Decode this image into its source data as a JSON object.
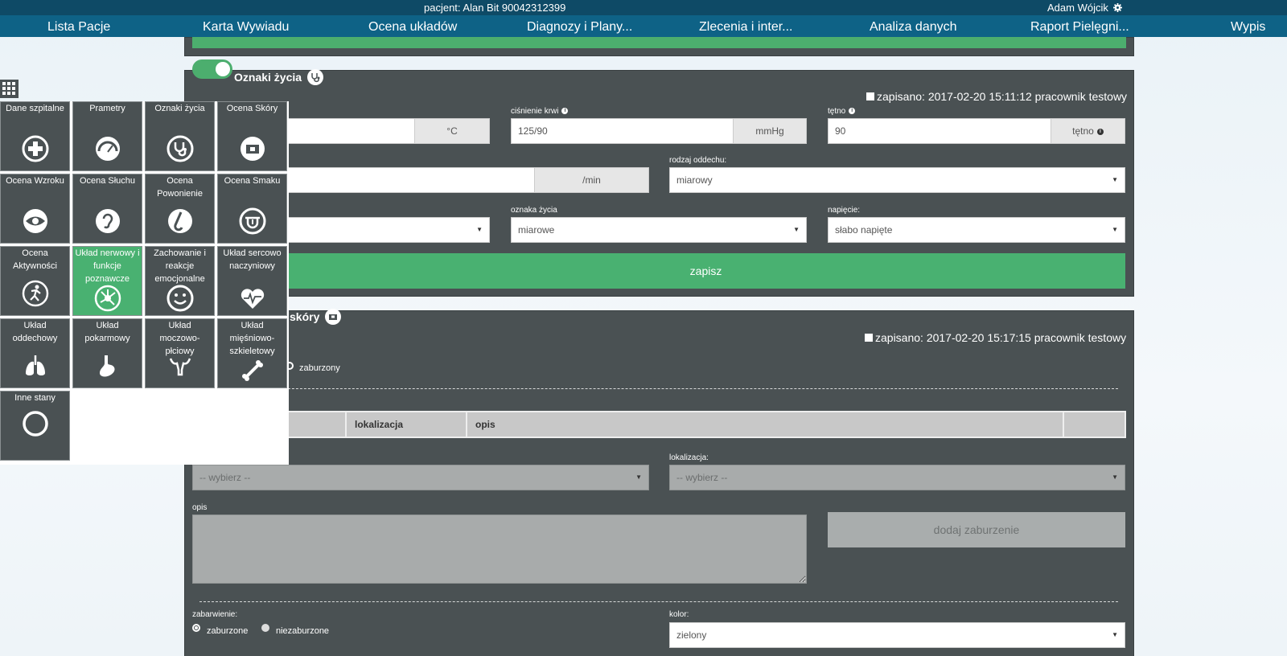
{
  "topbar": {
    "patient": "pacjent: Alan Bit 90042312399",
    "user": "Adam Wójcik",
    "user_icon": "gear-icon"
  },
  "nav": [
    {
      "label": "Lista Pacje"
    },
    {
      "label": "Karta Wywiadu"
    },
    {
      "label": "Ocena układów"
    },
    {
      "label": "Diagnozy i Plany..."
    },
    {
      "label": "Zlecenia i inter..."
    },
    {
      "label": "Analiza danych"
    },
    {
      "label": "Raport Pielęgni..."
    },
    {
      "label": "Wypis"
    }
  ],
  "vitals": {
    "title": "Oznaki życia",
    "enabled": true,
    "saved": "zapisano: 2017-02-20 15:11:12 pracownik testowy",
    "temp_unit": "°C",
    "bp_label": "ciśnienie krwi",
    "bp_value": "125/90",
    "bp_unit": "mmHg",
    "pulse_label": "tętno",
    "pulse_value": "90",
    "pulse_unit": "tętno",
    "resp_unit": "/min",
    "breath_type_label": "rodzaj oddechu:",
    "breath_type_value": "miarowy",
    "sign_label": "oznaka życia",
    "sign_value": "miarowe",
    "tension_label": "napięcie:",
    "tension_value": "słabo napięte",
    "save_button": "zapisz"
  },
  "skin": {
    "title": "skóry",
    "saved": "zapisano: 2017-02-20 15:17:15 pracownik testowy",
    "radio_zaburzony": "zaburzony",
    "table_headers": [
      "lokalizacja",
      "opis"
    ],
    "select1_placeholder": "-- wybierz --",
    "location_label": "lokalizacja:",
    "select2_placeholder": "-- wybierz --",
    "opis_label": "opis",
    "add_button": "dodaj zaburzenie",
    "color_section_label": "zabarwienie:",
    "radio_disturbed": "zaburzone",
    "radio_undisturbed": "niezaburzone",
    "color_label": "kolor:",
    "color_value": "zielony"
  },
  "tiles": [
    {
      "label": "Dane szpitalne",
      "icon": "medical-cross-icon"
    },
    {
      "label": "Prametry",
      "icon": "gauge-icon"
    },
    {
      "label": "Oznaki życia",
      "icon": "stethoscope-icon"
    },
    {
      "label": "Ocena Skóry",
      "icon": "skin-icon"
    },
    {
      "label": "Ocena Wzroku",
      "icon": "eye-icon"
    },
    {
      "label": "Ocena Słuchu",
      "icon": "ear-icon"
    },
    {
      "label": "Ocena Powonienie",
      "icon": "nose-icon"
    },
    {
      "label": "Ocena Smaku",
      "icon": "tongue-icon"
    },
    {
      "label": "Ocena Aktywności",
      "icon": "activity-icon"
    },
    {
      "label": "Układ nerwowy i funkcje poznawcze",
      "icon": "neuron-icon",
      "active": true
    },
    {
      "label": "Zachowanie i reakcje emocjonalne",
      "icon": "smiley-icon"
    },
    {
      "label": "Układ sercowo naczyniowy",
      "icon": "heart-icon"
    },
    {
      "label": "Układ oddechowy",
      "icon": "lungs-icon"
    },
    {
      "label": "Układ pokarmowy",
      "icon": "stomach-icon"
    },
    {
      "label": "Układ moczowo-płciowy",
      "icon": "uterus-icon"
    },
    {
      "label": "Układ mięśniowo-szkieletowy",
      "icon": "bone-icon"
    },
    {
      "label": "Inne stany",
      "icon": "circle-icon"
    }
  ]
}
